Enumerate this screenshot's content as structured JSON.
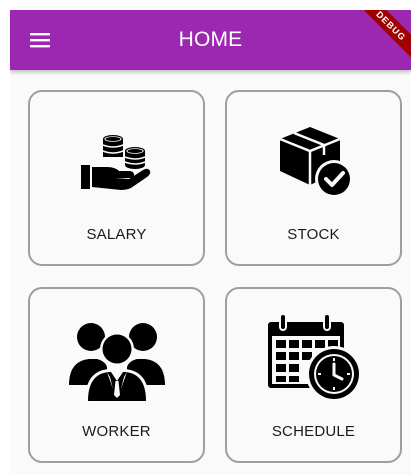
{
  "app_bar": {
    "title": "HOME",
    "menu_icon": "hamburger-menu-icon",
    "color": "#9c27b0",
    "debug_banner": "DEBUG"
  },
  "cards": [
    {
      "label": "SALARY",
      "icon": "salary-coins-hand-icon"
    },
    {
      "label": "STOCK",
      "icon": "stock-box-check-icon"
    },
    {
      "label": "WORKER",
      "icon": "worker-group-icon"
    },
    {
      "label": "SCHEDULE",
      "icon": "schedule-calendar-clock-icon"
    }
  ]
}
